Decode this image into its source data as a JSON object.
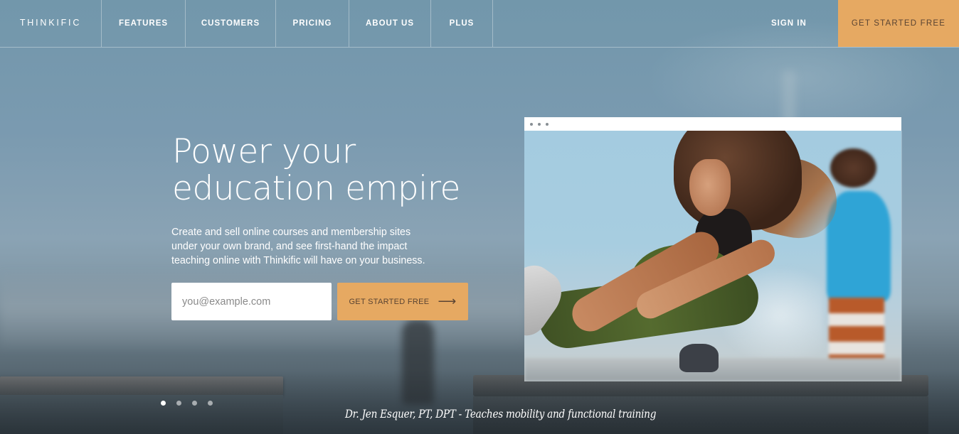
{
  "colors": {
    "accent": "#e6a962",
    "accent_text": "#5a4432",
    "nav_text": "#ffffff"
  },
  "nav": {
    "logo": "THINKIFIC",
    "items": [
      {
        "label": "FEATURES"
      },
      {
        "label": "CUSTOMERS"
      },
      {
        "label": "PRICING"
      },
      {
        "label": "ABOUT US"
      },
      {
        "label": "PLUS"
      }
    ],
    "sign_in": "SIGN IN",
    "cta": "GET STARTED FREE"
  },
  "hero": {
    "title": "Power your education empire",
    "subtitle": "Create and sell online courses and membership sites under your own brand, and see first-hand the impact teaching online with Thinkific will have on your business.",
    "email_placeholder": "you@example.com",
    "email_value": "",
    "cta_label": "GET STARTED FREE",
    "cta_icon": "arrow-right-icon",
    "cta_arrow": "⟶"
  },
  "slider": {
    "total": 4,
    "active_index": 0
  },
  "caption": "Dr. Jen Esquer, PT, DPT - Teaches mobility and functional training"
}
